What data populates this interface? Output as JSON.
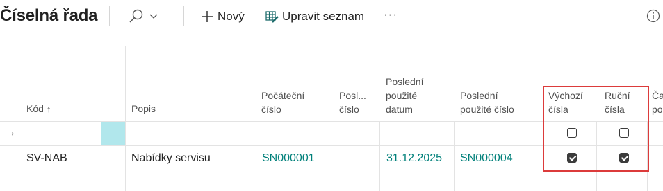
{
  "header": {
    "title": "Číselná řada",
    "search_icon": "search-icon",
    "dropdown_icon": "chevron-down-icon",
    "new_label": "Nový",
    "edit_list_label": "Upravit seznam",
    "more_label": "···",
    "info_icon": "info-icon"
  },
  "grid": {
    "columns": {
      "code": "Kód",
      "description": "Popis",
      "starting_number_line1": "Počáteční",
      "starting_number_line2": "číslo",
      "last_number_line1": "Posl...",
      "last_number_line2": "číslo",
      "last_date_line1": "Poslední",
      "last_date_line2": "použité",
      "last_date_line3": "datum",
      "last_used_line1": "Poslední",
      "last_used_line2": "použité číslo",
      "default_nos_line1": "Výchozí",
      "default_nos_line2": "čísla",
      "manual_nos_line1": "Ruční",
      "manual_nos_line2": "čísla",
      "cut_col_line1": "Ča",
      "cut_col_line2": "po"
    },
    "sort_icon": "arrow-up-icon",
    "new_row_indicator": "→",
    "rows": [
      {
        "code": "SV-NAB",
        "description": "Nabídky servisu",
        "starting_number": "SN000001",
        "last_number": "_",
        "last_date_used": "31.12.2025",
        "last_number_used": "SN000004",
        "default_nos": true,
        "manual_nos": true
      }
    ],
    "new_row": {
      "default_nos": false,
      "manual_nos": false
    }
  },
  "colors": {
    "accent": "#00807a",
    "highlight": "#dc3b3b",
    "selected_cell": "#b1e7ec"
  }
}
